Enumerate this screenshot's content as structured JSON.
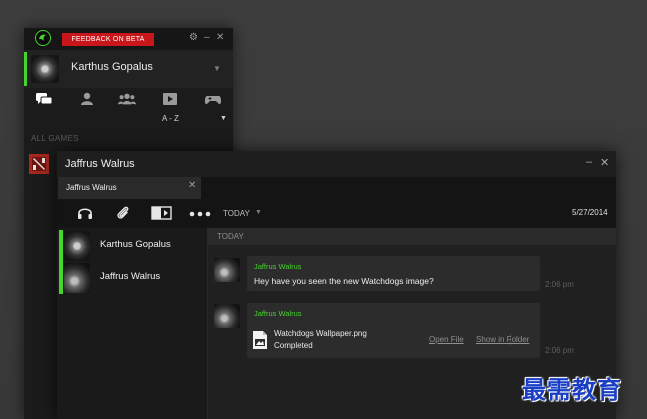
{
  "main_window": {
    "feedback_label": "FEEDBACK ON BETA",
    "settings_icon": "gear-icon",
    "minimize_glyph": "–",
    "close_glyph": "✕",
    "profile_name": "Karthus Gopalus",
    "sort_label": "A - Z",
    "section_label": "ALL GAMES",
    "tabs": [
      "chat-icon",
      "friend-icon",
      "group-icon",
      "video-icon",
      "gamepad-icon"
    ]
  },
  "chat_window": {
    "title": "Jaffrus Walrus",
    "minimize_glyph": "–",
    "close_glyph": "✕",
    "tab_label": "Jaffrus Walrus",
    "tab_close": "✕",
    "toolbar": {
      "today_label": "TODAY",
      "date": "5/27/2014"
    },
    "contacts": [
      {
        "name": "Karthus Gopalus"
      },
      {
        "name": "Jaffrus Walrus"
      }
    ],
    "day_header": "TODAY",
    "messages": [
      {
        "from": "Jaffrus Walrus",
        "text": "Hey have you seen the new Watchdogs image?",
        "time": "2:06 pm"
      },
      {
        "from": "Jaffrus Walrus",
        "file_name": "Watchdogs Wallpaper.png",
        "status": "Completed",
        "open_label": "Open File",
        "folder_label": "Show in Folder",
        "time": "2:06 pm"
      }
    ]
  },
  "watermark": "最需教育",
  "colors": {
    "accent": "#44d62c",
    "feedback": "#c8161b"
  }
}
